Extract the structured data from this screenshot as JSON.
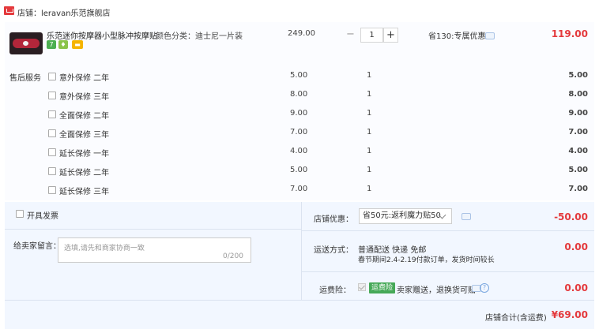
{
  "shop": {
    "label": "店铺：",
    "name": "leravan乐范旗舰店"
  },
  "product": {
    "title": "乐范迷你按摩器小型脉冲按摩贴...",
    "attribute": "颜色分类：迪士尼一片装",
    "unit_price": "249.00",
    "quantity": "1",
    "discount": "省130:专属优惠",
    "subtotal": "119.00",
    "badges": [
      "7",
      "",
      ""
    ],
    "minus": "−",
    "plus": "+"
  },
  "services": {
    "label": "售后服务",
    "items": [
      {
        "name": "意外保修 二年",
        "price": "5.00",
        "qty": "1",
        "total": "5.00"
      },
      {
        "name": "意外保修 三年",
        "price": "8.00",
        "qty": "1",
        "total": "8.00"
      },
      {
        "name": "全面保修 二年",
        "price": "9.00",
        "qty": "1",
        "total": "9.00"
      },
      {
        "name": "全面保修 三年",
        "price": "7.00",
        "qty": "1",
        "total": "7.00"
      },
      {
        "name": "延长保修 一年",
        "price": "4.00",
        "qty": "1",
        "total": "4.00"
      },
      {
        "name": "延长保修 二年",
        "price": "5.00",
        "qty": "1",
        "total": "5.00"
      },
      {
        "name": "延长保修 三年",
        "price": "7.00",
        "qty": "1",
        "total": "7.00"
      }
    ]
  },
  "invoice": {
    "label": "开具发票"
  },
  "message": {
    "label": "给卖家留言：",
    "placeholder": "选填,请先和商家协商一致",
    "count": "0/200"
  },
  "shop_discount": {
    "label": "店铺优惠：",
    "selected": "省50元:返利魔力贴50",
    "amount": "-50.00"
  },
  "delivery": {
    "label": "运送方式：",
    "method": "普通配送 快递 免邮",
    "note": "春节期间2.4-2.19付款订单，发货时间较长",
    "amount": "0.00"
  },
  "insurance": {
    "label": "运费险：",
    "tag": "运费险",
    "text": "卖家赠送，退换货可赔",
    "amount": "0.00"
  },
  "total": {
    "label": "店铺合计(含运费)",
    "amount": "¥69.00"
  },
  "colors": {
    "price_red": "#e4393c",
    "panel_blue": "#f2f7ff",
    "tag_green": "#46a958"
  }
}
